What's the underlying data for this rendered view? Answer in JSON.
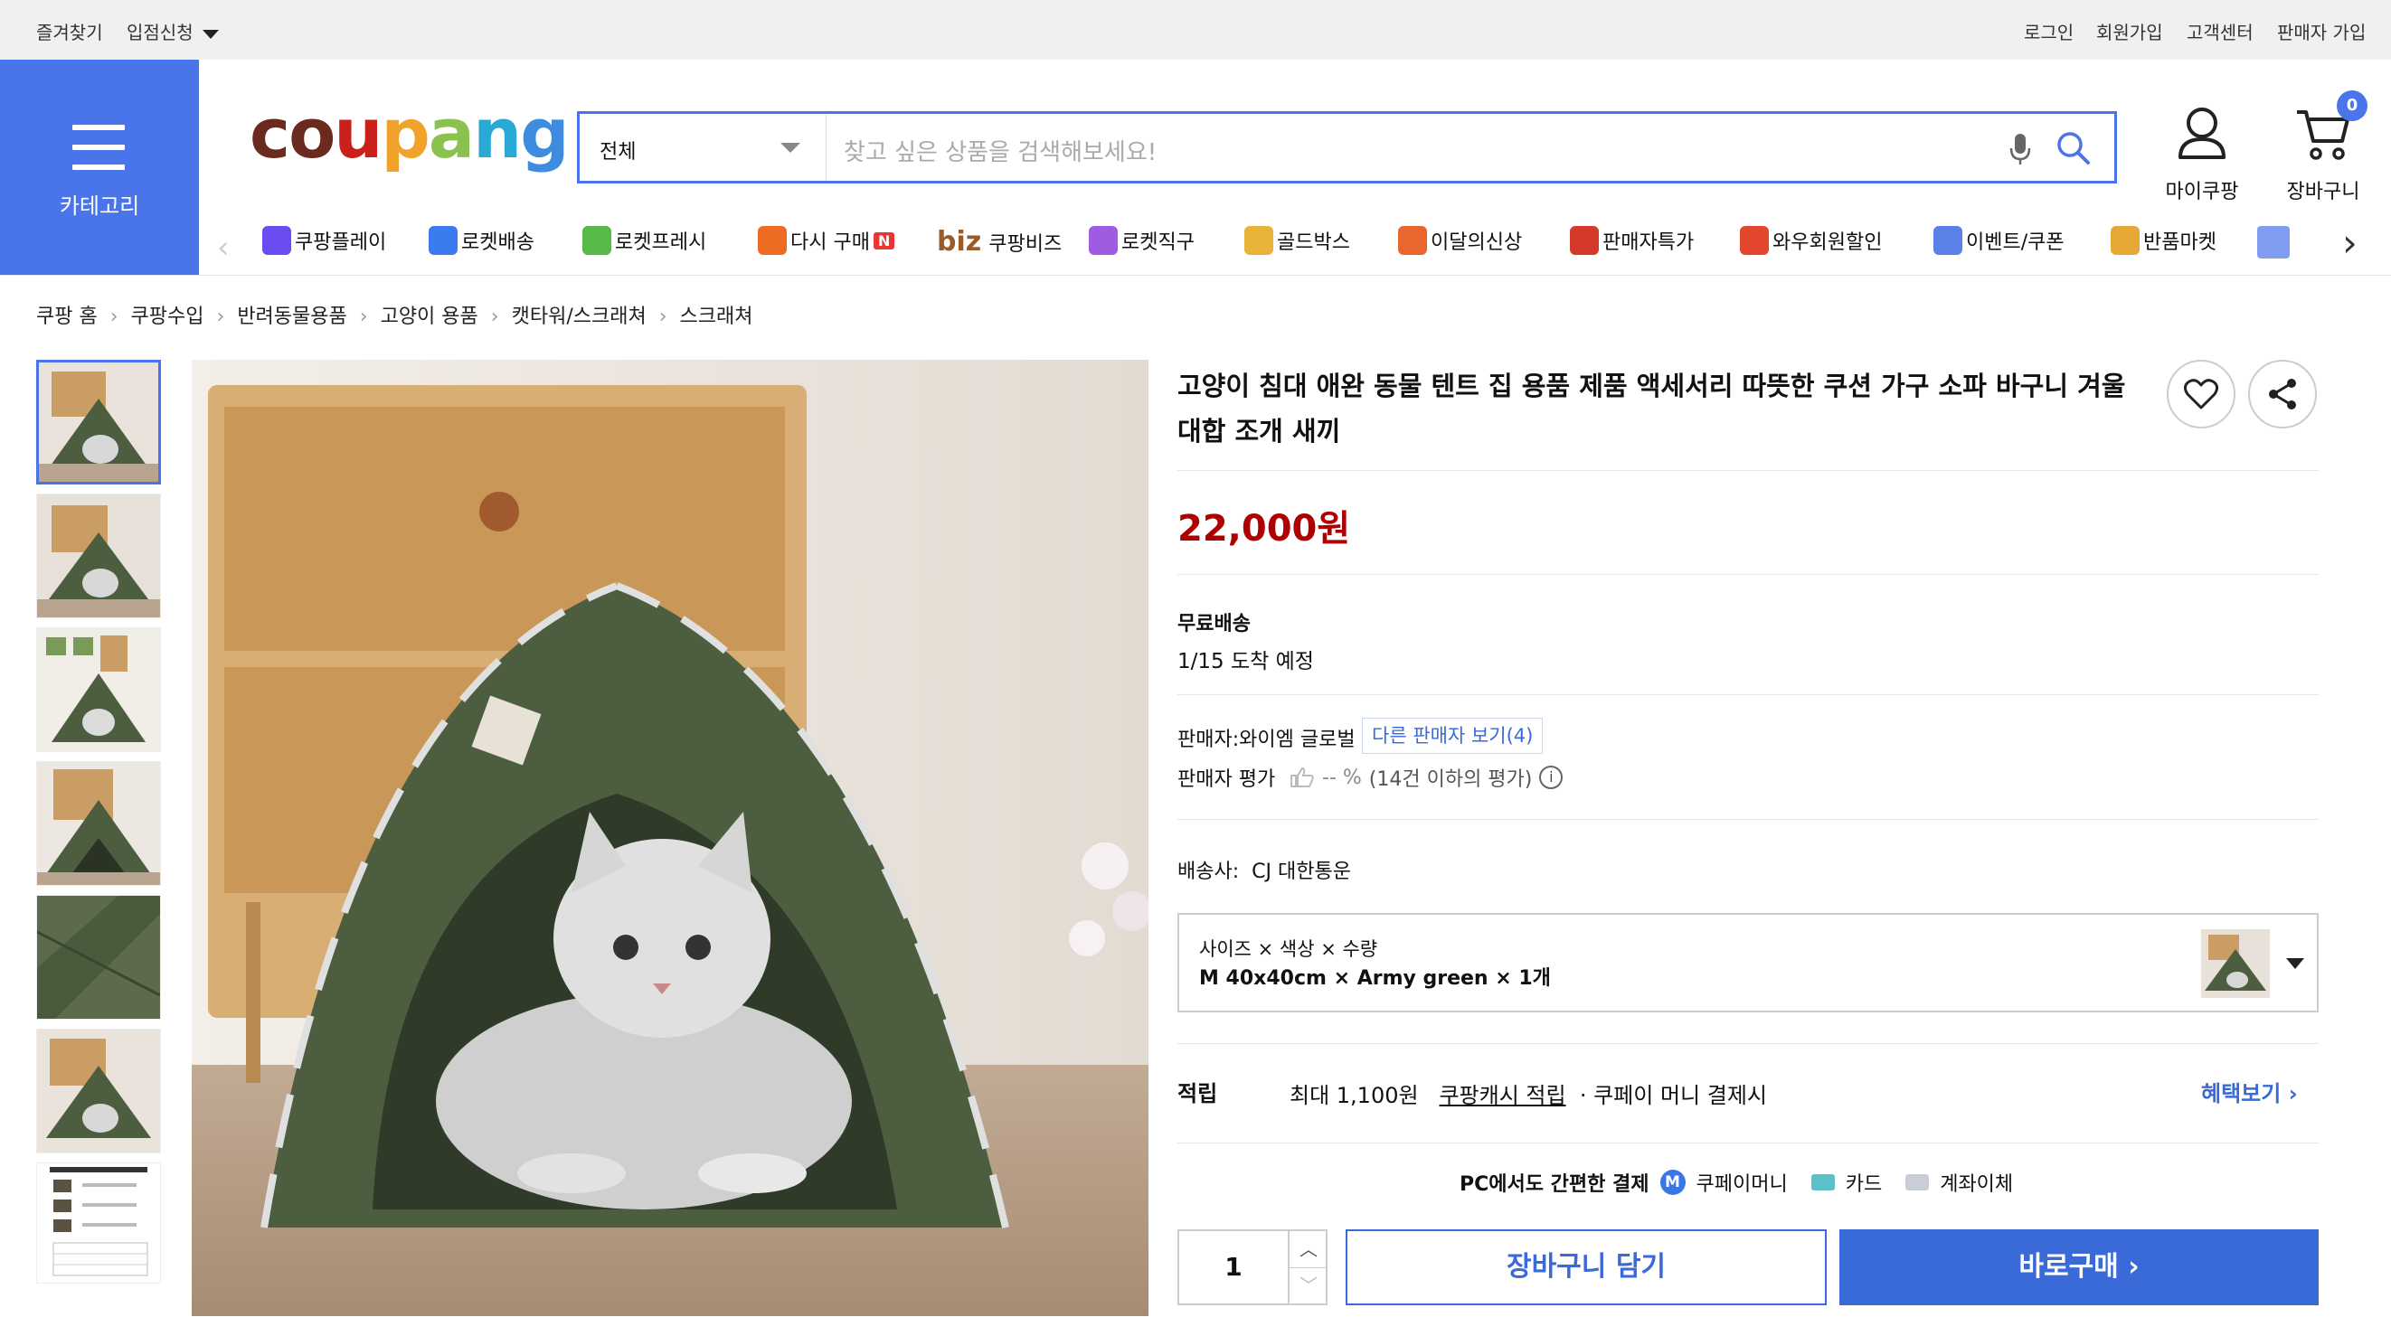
{
  "topbar": {
    "bookmark": "즐겨찾기",
    "apply": "입점신청",
    "login": "로그인",
    "signup": "회원가입",
    "support": "고객센터",
    "seller_join": "판매자 가입"
  },
  "header": {
    "category_label": "카테고리",
    "logo": "coupang",
    "search_scope": "전체",
    "search_placeholder": "찾고 싶은 상품을 검색해보세요!",
    "mycoupang": "마이쿠팡",
    "cart": "장바구니",
    "cart_count": "0"
  },
  "category_strip": [
    {
      "label": "쿠팡플레이",
      "icon": "play-icon",
      "color": "#6a4cf0"
    },
    {
      "label": "로켓배송",
      "icon": "rocket-icon",
      "color": "#3b7bf0"
    },
    {
      "label": "로켓프레시",
      "icon": "rocket-fresh-icon",
      "color": "#57b947"
    },
    {
      "label": "다시 구매",
      "icon": "basket-icon",
      "color": "#ee6b22",
      "badge": "N"
    },
    {
      "label": "쿠팡비즈",
      "icon": "biz-icon",
      "color": "#9b5a2a",
      "prefix": "biz"
    },
    {
      "label": "로켓직구",
      "icon": "rocket-global-icon",
      "color": "#a05be3"
    },
    {
      "label": "골드박스",
      "icon": "gold-box-icon",
      "color": "#e9b33a"
    },
    {
      "label": "이달의신상",
      "icon": "new-bag-icon",
      "color": "#e9662f"
    },
    {
      "label": "판매자특가",
      "icon": "percent-icon",
      "color": "#d33a2a"
    },
    {
      "label": "와우회원할인",
      "icon": "wow-icon",
      "color": "#e2462d"
    },
    {
      "label": "이벤트/쿠폰",
      "icon": "coupon-icon",
      "color": "#5b80e6"
    },
    {
      "label": "반품마켓",
      "icon": "return-market-icon",
      "color": "#e7a838"
    }
  ],
  "breadcrumb": [
    "쿠팡 홈",
    "쿠팡수입",
    "반려동물용품",
    "고양이 용품",
    "캣타워/스크래쳐",
    "스크래쳐"
  ],
  "product": {
    "title_line1": "고양이 침대 애완 동물 텐트 집 용품 제품 액세서리 따뜻한 쿠션 가구 소파 바구니 겨울",
    "title_line2": "대합 조개 새끼",
    "price": "22,000원",
    "shipping_label": "무료배송",
    "arrival": "1/15 도착 예정",
    "seller_label": "판매자:",
    "seller_name": "와이엠 글로벌",
    "other_sellers": "다른 판매자 보기(4)",
    "rating_label": "판매자 평가",
    "rating_value": "-- %",
    "rating_note": "(14건 이하의 평가)",
    "carrier_label": "배송사:",
    "carrier": "CJ 대한통운",
    "option_header": "사이즈 × 색상 × 수량",
    "option_value": "M 40x40cm × Army green × 1개",
    "reward_label": "적립",
    "reward_max": "최대 1,100원",
    "reward_link": "쿠팡캐시 적립",
    "reward_note": "· 쿠페이 머니 결제시",
    "benefit_link": "혜택보기",
    "pay_title": "PC에서도 간편한 결제",
    "pay_methods": [
      "쿠페이머니",
      "카드",
      "계좌이체"
    ],
    "quantity": "1",
    "add_cart": "장바구니 담기",
    "buy_now": "바로구매"
  },
  "colors": {
    "accent": "#4a74e9",
    "price": "#ae0000",
    "tent": "#4d5d40"
  }
}
